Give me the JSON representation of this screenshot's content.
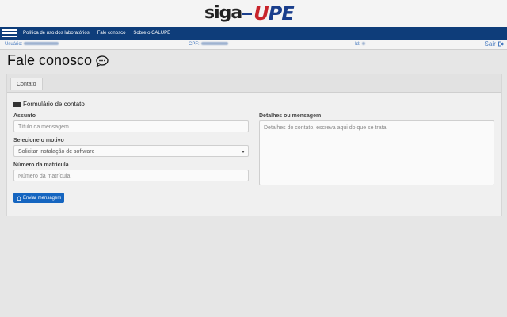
{
  "header": {
    "logo_left": "siga",
    "logo_right_u": "U",
    "logo_right_pe": "PE"
  },
  "nav": {
    "items": [
      "Política de uso dos laboratórios",
      "Fale conosco",
      "Sobre o CALUPE"
    ]
  },
  "userbar": {
    "usuario_label": "Usuário:",
    "cpf_label": "CPF:",
    "id_label": "Id:",
    "logout": "Sair"
  },
  "page": {
    "title": "Fale conosco"
  },
  "tabs": [
    {
      "label": "Contato"
    }
  ],
  "form": {
    "title": "Formulário de contato",
    "assunto_label": "Assunto",
    "assunto_placeholder": "Título da mensagem",
    "motivo_label": "Selecione o motivo",
    "motivo_value": "Solicitar instalação de software",
    "matricula_label": "Número da matrícula",
    "matricula_placeholder": "Número da matrícula",
    "detalhes_label": "Detalhes ou mensagem",
    "detalhes_placeholder": "Detalhes do contato, escreva aqui do que se trata.",
    "submit_label": "Enviar mensagem"
  },
  "colors": {
    "navbar": "#0e3d7a",
    "button": "#1565c0",
    "logo_red": "#c8242b"
  }
}
